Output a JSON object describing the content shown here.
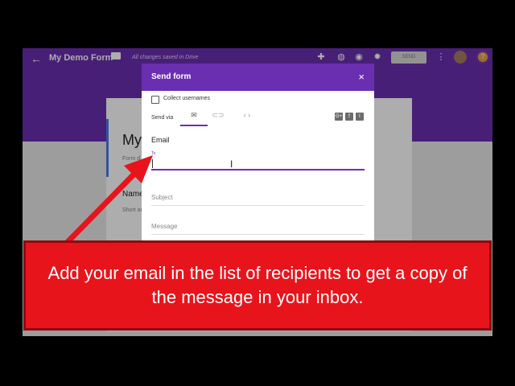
{
  "form_editor": {
    "title": "My Demo Form",
    "saved_status": "All changes saved in Drive",
    "send_label": "SEND",
    "background_title": "My",
    "background_description": "Form d",
    "background_question": "Name",
    "background_answer_hint": "Short an"
  },
  "send_dialog": {
    "title": "Send form",
    "close_symbol": "×",
    "collect_usernames_label": "Collect usernames",
    "send_via_label": "Send via",
    "email_section_label": "Email",
    "to_label": "To",
    "to_value": "",
    "subject_placeholder": "Subject",
    "message_placeholder": "Message"
  },
  "banner": {
    "text": "Add your email in the list of recipients to get a copy of the message in your inbox."
  },
  "colors": {
    "accent": "#6a2fb0",
    "banner": "#e8141c",
    "arrow": "#e8141c"
  },
  "icons": {
    "back": "arrow-left-icon",
    "folder": "folder-icon",
    "addons": "puzzle-icon",
    "palette": "palette-icon",
    "preview": "eye-icon",
    "settings": "gear-icon",
    "more": "more-vert-icon",
    "email_tab": "envelope-icon",
    "link_tab": "link-icon",
    "embed_tab": "code-icon",
    "share": [
      "google-plus-icon",
      "facebook-icon",
      "twitter-icon"
    ]
  }
}
